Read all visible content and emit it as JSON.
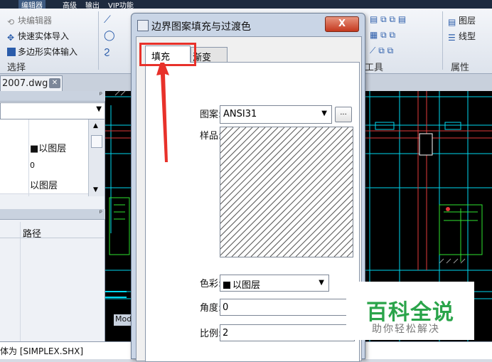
{
  "menubar": {
    "edit": "编辑器",
    "advanced": "高级",
    "output": "输出",
    "vip": "VIP功能"
  },
  "ribbon": {
    "block_editor": "块编辑器",
    "quick_solid_import": "快速实体导入",
    "polygon_solid_input": "多边形实体输入",
    "select_group": "选择",
    "tools_group": "工具",
    "layer": "图层",
    "linetype": "线型",
    "properties_group": "属性"
  },
  "file_tab": {
    "label": "2007.dwg",
    "close": "✕"
  },
  "palette": {
    "row1": "■以图层",
    "row2": "0",
    "row3": "以图层",
    "path_header": "路径"
  },
  "model_tab": "Mod",
  "command_line": "体为 [SIMPLEX.SHX]",
  "dialog": {
    "title": "边界图案填充与过渡色",
    "close": "X",
    "tabs": {
      "fill": "填充",
      "gradient": "渐变"
    },
    "pattern_label": "图案:",
    "pattern_value": "ANSI31",
    "more_button": "...",
    "sample_label": "样品:",
    "color_label": "色彩:",
    "color_value": "以图层",
    "angle_label": "角度:",
    "angle_value": "0",
    "scale_label": "比例:",
    "scale_value": "2"
  },
  "watermark": {
    "title": "百科全说",
    "subtitle": "助你轻松解决"
  },
  "colors": {
    "annotation_red": "#e8312a",
    "watermark_green": "#2aa44a",
    "cad_cyan": "#00e5ff",
    "cad_green": "#22dd22"
  }
}
